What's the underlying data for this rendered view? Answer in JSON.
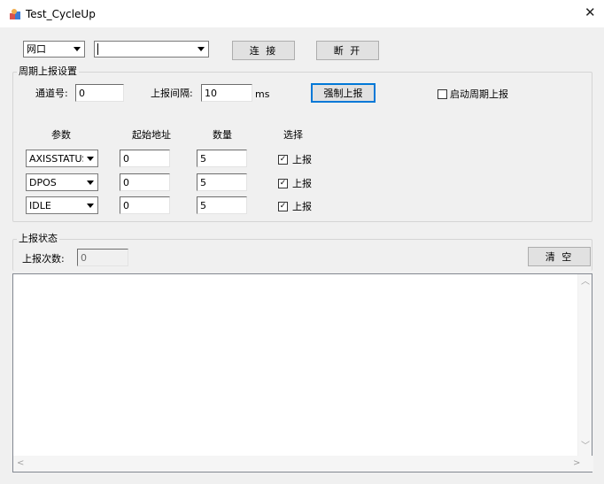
{
  "window": {
    "title": "Test_CycleUp",
    "close_glyph": "✕"
  },
  "connection": {
    "type_value": "网口",
    "address_value": "",
    "connect_label": "连 接",
    "disconnect_label": "断 开"
  },
  "period_group": {
    "title": "周期上报设置",
    "channel_label": "通道号:",
    "channel_value": "0",
    "interval_label": "上报间隔:",
    "interval_value": "10",
    "interval_unit": "ms",
    "force_button": "强制上报",
    "enable_label": "启动周期上报",
    "enable_checked": false,
    "headers": {
      "param": "参数",
      "start_addr": "起始地址",
      "count": "数量",
      "select": "选择"
    },
    "rows": [
      {
        "param": "AXISSTATUS",
        "start_addr": "0",
        "count": "5",
        "select_label": "上报",
        "checked": true
      },
      {
        "param": "DPOS",
        "start_addr": "0",
        "count": "5",
        "select_label": "上报",
        "checked": true
      },
      {
        "param": "IDLE",
        "start_addr": "0",
        "count": "5",
        "select_label": "上报",
        "checked": true
      }
    ]
  },
  "status_group": {
    "title": "上报状态",
    "count_label": "上报次数:",
    "count_value": "0",
    "clear_button": "清 空"
  },
  "log": {
    "text": ""
  },
  "colors": {
    "background": "#f0f0f0",
    "focus_border": "#0078d7",
    "button_face": "#e1e1e1"
  },
  "icons": {
    "app": "app-icon",
    "close": "close-icon",
    "dropdown": "chevron-down-icon",
    "check": "checkmark-icon"
  }
}
